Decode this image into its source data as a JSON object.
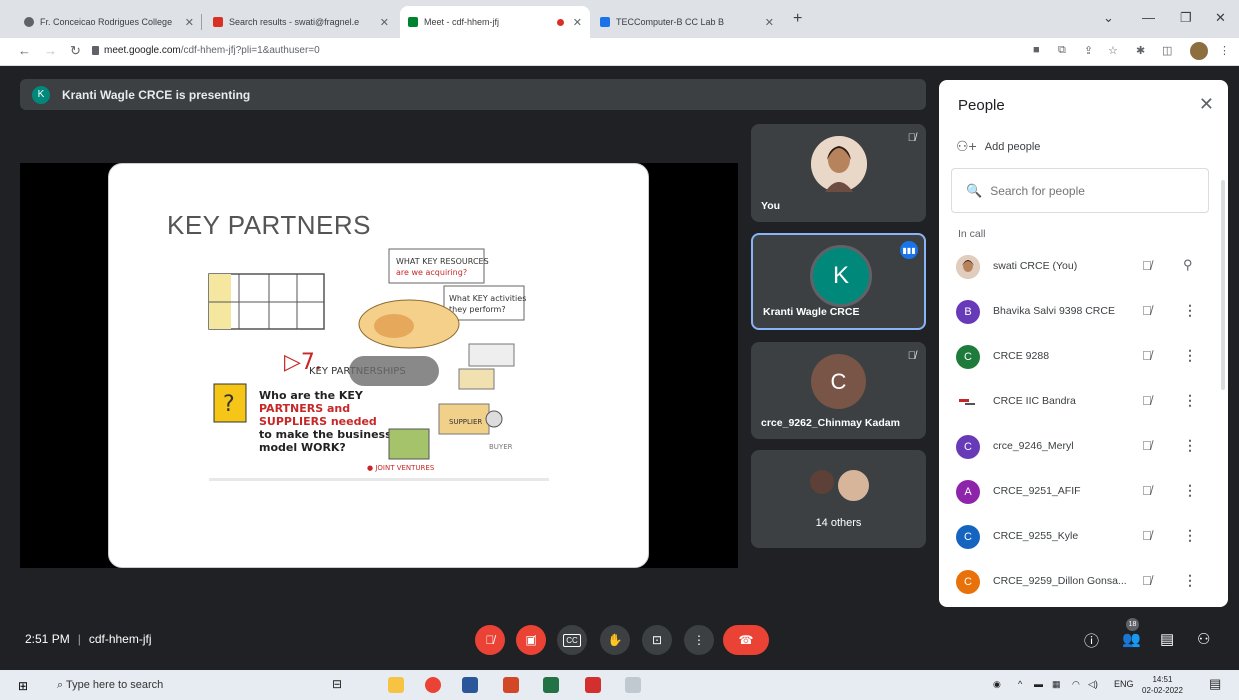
{
  "browser": {
    "tabs": [
      {
        "label": "Fr. Conceicao Rodrigues College",
        "color": "#5f6368"
      },
      {
        "label": "Search results - swati@fragnel.e",
        "color": "#d93025"
      },
      {
        "label": "Meet - cdf-hhem-jfj",
        "color": "#00832d",
        "active": true
      },
      {
        "label": "TECComputer-B CC Lab B",
        "color": "#1a73e8"
      }
    ],
    "url_host": "meet.google.com",
    "url_path": "/cdf-hhem-jfj?pli=1&authuser=0"
  },
  "banner": {
    "avatar_letter": "K",
    "text": "Kranti Wagle CRCE is presenting"
  },
  "slide": {
    "title": "KEY PARTNERS"
  },
  "tiles": [
    {
      "name": "You",
      "kind": "photo"
    },
    {
      "name": "Kranti Wagle CRCE",
      "letter": "K",
      "color": "#00897b",
      "speaking": true
    },
    {
      "name": "crce_9262_Chinmay Kadam",
      "letter": "C",
      "color": "#795548"
    },
    {
      "name": "14 others",
      "kind": "group"
    }
  ],
  "people": {
    "title": "People",
    "add_label": "Add people",
    "search_placeholder": "Search for people",
    "section_label": "In call",
    "list": [
      {
        "name": "swati CRCE (You)",
        "letter": "",
        "color": "#8d6e3f"
      },
      {
        "name": "Bhavika Salvi 9398 CRCE",
        "letter": "B",
        "color": "#673ab7"
      },
      {
        "name": "CRCE 9288",
        "letter": "C",
        "color": "#1e7b3c"
      },
      {
        "name": "CRCE IIC Bandra",
        "letter": "",
        "color": "#ffffff"
      },
      {
        "name": "crce_9246_Meryl",
        "letter": "C",
        "color": "#673ab7"
      },
      {
        "name": "CRCE_9251_AFIF",
        "letter": "A",
        "color": "#8e24aa"
      },
      {
        "name": "CRCE_9255_Kyle",
        "letter": "C",
        "color": "#1565c0"
      },
      {
        "name": "CRCE_9259_Dillon Gonsa...",
        "letter": "C",
        "color": "#e8710a"
      }
    ]
  },
  "meeting": {
    "time": "2:51 PM",
    "code": "cdf-hhem-jfj",
    "participant_count": "18"
  },
  "taskbar": {
    "search_placeholder": "Type here to search",
    "lang": "ENG",
    "time": "14:51",
    "date": "02-02-2022"
  }
}
